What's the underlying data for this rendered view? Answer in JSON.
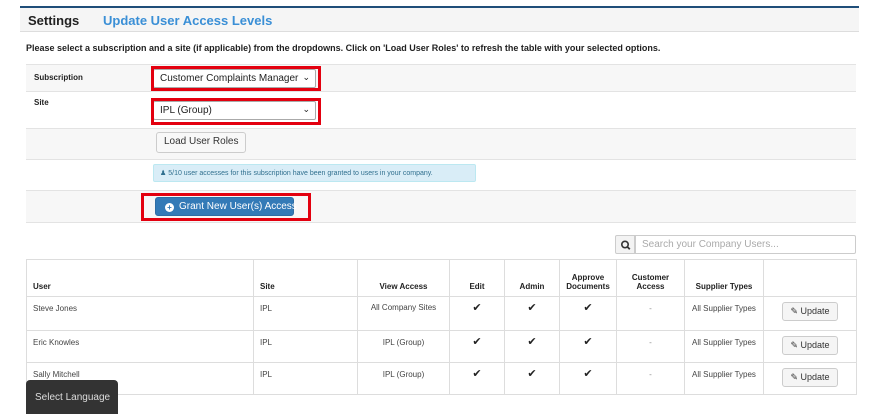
{
  "header": {
    "settings": "Settings",
    "subtitle": "Update User Access Levels"
  },
  "instructions": "Please select a subscription and a site (if applicable) from the dropdowns. Click on 'Load User Roles' to refresh the table with your selected options.",
  "form": {
    "subscription_label": "Subscription",
    "subscription_value": "Customer Complaints Manager",
    "site_label": "Site",
    "site_value": "IPL (Group)",
    "load_button": "Load User Roles",
    "info_text": "5/10 user accesses for this subscription have been granted to users in your company.",
    "grant_button": "Grant New User(s) Access"
  },
  "search": {
    "placeholder": "Search your Company Users..."
  },
  "table": {
    "headers": [
      "User",
      "Site",
      "View Access",
      "Edit",
      "Admin",
      "Approve Documents",
      "Customer Access",
      "Supplier Types",
      ""
    ],
    "rows": [
      {
        "user": "Steve Jones",
        "site": "IPL",
        "view": "All Company Sites",
        "edit": "✔",
        "admin": "✔",
        "approve": "✔",
        "customer": "-",
        "supplier": "All Supplier Types",
        "action": "Update"
      },
      {
        "user": "Eric Knowles",
        "site": "IPL",
        "view": "IPL (Group)",
        "edit": "✔",
        "admin": "✔",
        "approve": "✔",
        "customer": "-",
        "supplier": "All Supplier Types",
        "action": "Update"
      },
      {
        "user": "Sally Mitchell",
        "site": "IPL",
        "view": "IPL (Group)",
        "edit": "✔",
        "admin": "✔",
        "approve": "✔",
        "customer": "-",
        "supplier": "All Supplier Types",
        "action": "Update"
      }
    ]
  },
  "language": "Select Language",
  "colors": {
    "accent": "#3a8fd6",
    "primary_button": "#337ab7",
    "highlight_border": "#e3000f",
    "info_bg": "#d9edf7"
  }
}
